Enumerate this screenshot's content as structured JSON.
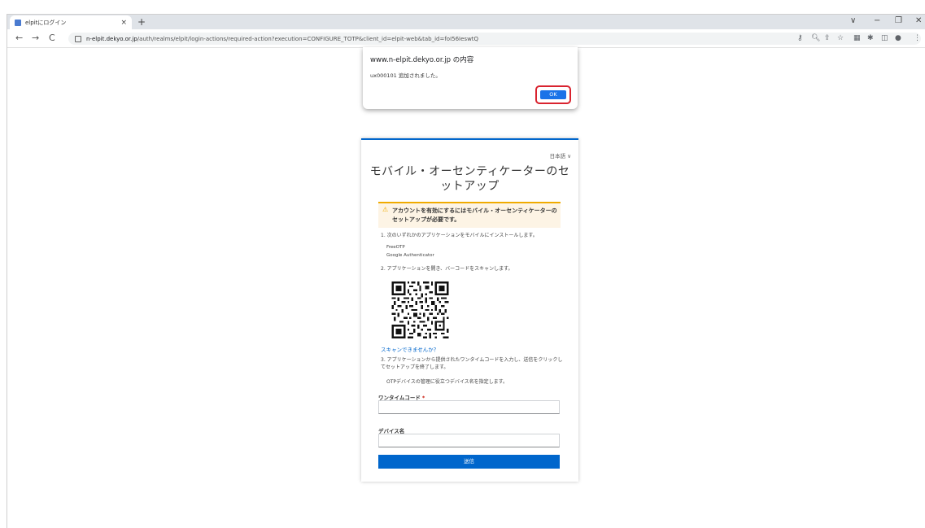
{
  "browser": {
    "tab_title": "elpitにログイン",
    "tab_close": "×",
    "new_tab": "+",
    "window_controls": [
      "∨",
      "−",
      "❐",
      "✕"
    ],
    "url_host": "n-elpit.dekyo.or.jp",
    "url_path": "/auth/realms/elpit/login-actions/required-action?execution=CONFIGURE_TOTP&client_id=elpit-web&tab_id=foI56IeswtQ",
    "toolbar_icons": [
      "key-icon",
      "zoom-icon",
      "share-icon",
      "star-icon",
      "extension-icon",
      "puzzle-icon",
      "sidepanel-icon",
      "profile-icon",
      "menu-icon"
    ]
  },
  "dialog": {
    "title": "www.n-elpit.dekyo.or.jp の内容",
    "message": "ux000101 追加されました。",
    "ok_label": "OK"
  },
  "card": {
    "language": "日本語 ∨",
    "heading_line1": "モバイル・オーセンティケーターのセ",
    "heading_line2": "ットアップ",
    "warning_icon": "⚠",
    "warning_text": "アカウントを有効にするにはモバイル・オーセンティケーターのセットアップが必要です。",
    "step1": "1. 次のいずれかのアプリケーションをモバイルにインストールします。",
    "app1": "FreeOTP",
    "app2": "Google Authenticator",
    "step2": "2. アプリケーションを開き、バーコードをスキャンします。",
    "scan_link": "スキャンできませんか？",
    "step3": "3. アプリケーションから提供されたワンタイムコードを入力し、送信をクリックしてセットアップを終了します。",
    "step3b": "OTPデバイスの管理に役立つデバイス名を指定します。",
    "otp_label": "ワンタイムコード",
    "required_mark": "*",
    "device_label": "デバイス名",
    "submit_label": "送信"
  }
}
